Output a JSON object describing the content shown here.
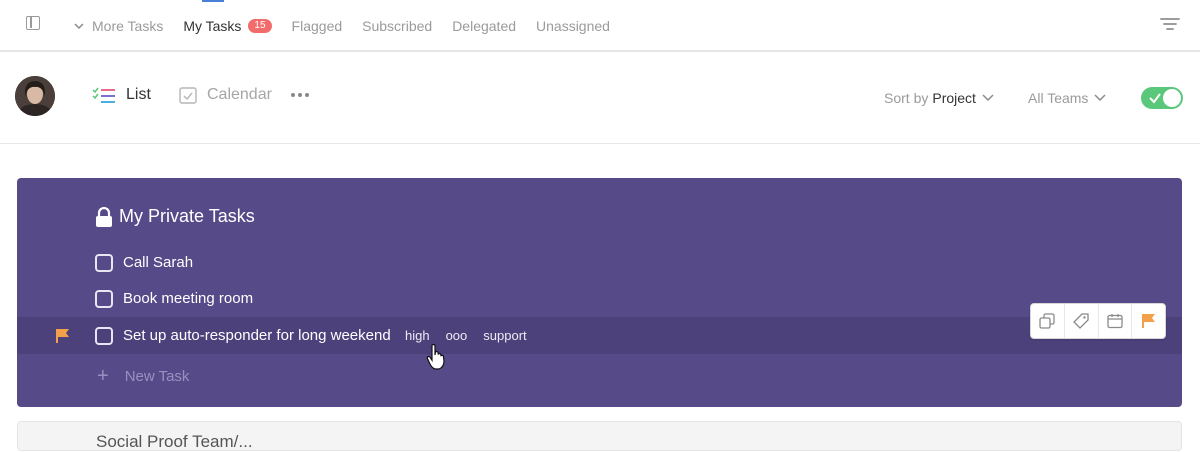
{
  "topnav": {
    "items": [
      {
        "label": "More Tasks"
      },
      {
        "label": "My Tasks",
        "badge": "15"
      },
      {
        "label": "Flagged"
      },
      {
        "label": "Subscribed"
      },
      {
        "label": "Delegated"
      },
      {
        "label": "Unassigned"
      }
    ],
    "active_index": 1
  },
  "toolbar": {
    "views": [
      {
        "label": "List",
        "active": true,
        "icon": "list-icon"
      },
      {
        "label": "Calendar",
        "active": false,
        "icon": "calendar-icon"
      }
    ],
    "sort": {
      "prefix": "Sort by",
      "value": "Project"
    },
    "teams": {
      "label": "All Teams"
    },
    "toggle_on": true
  },
  "project": {
    "title": "My Private Tasks",
    "icon": "lock-icon",
    "tasks": [
      {
        "label": "Call Sarah",
        "flagged": false,
        "tags": []
      },
      {
        "label": "Book meeting room",
        "flagged": false,
        "tags": []
      },
      {
        "label": "Set up auto-responder for long weekend",
        "flagged": true,
        "tags": [
          "high",
          "ooo",
          "support"
        ]
      }
    ],
    "new_task_label": "New Task"
  },
  "next_project": {
    "title": "Social Proof Team/..."
  },
  "colors": {
    "card_bg": "#574a89",
    "row_highlight": "#4d417b",
    "badge": "#f26c6c",
    "flag": "#f4a04a",
    "toggle": "#5ac77a"
  }
}
